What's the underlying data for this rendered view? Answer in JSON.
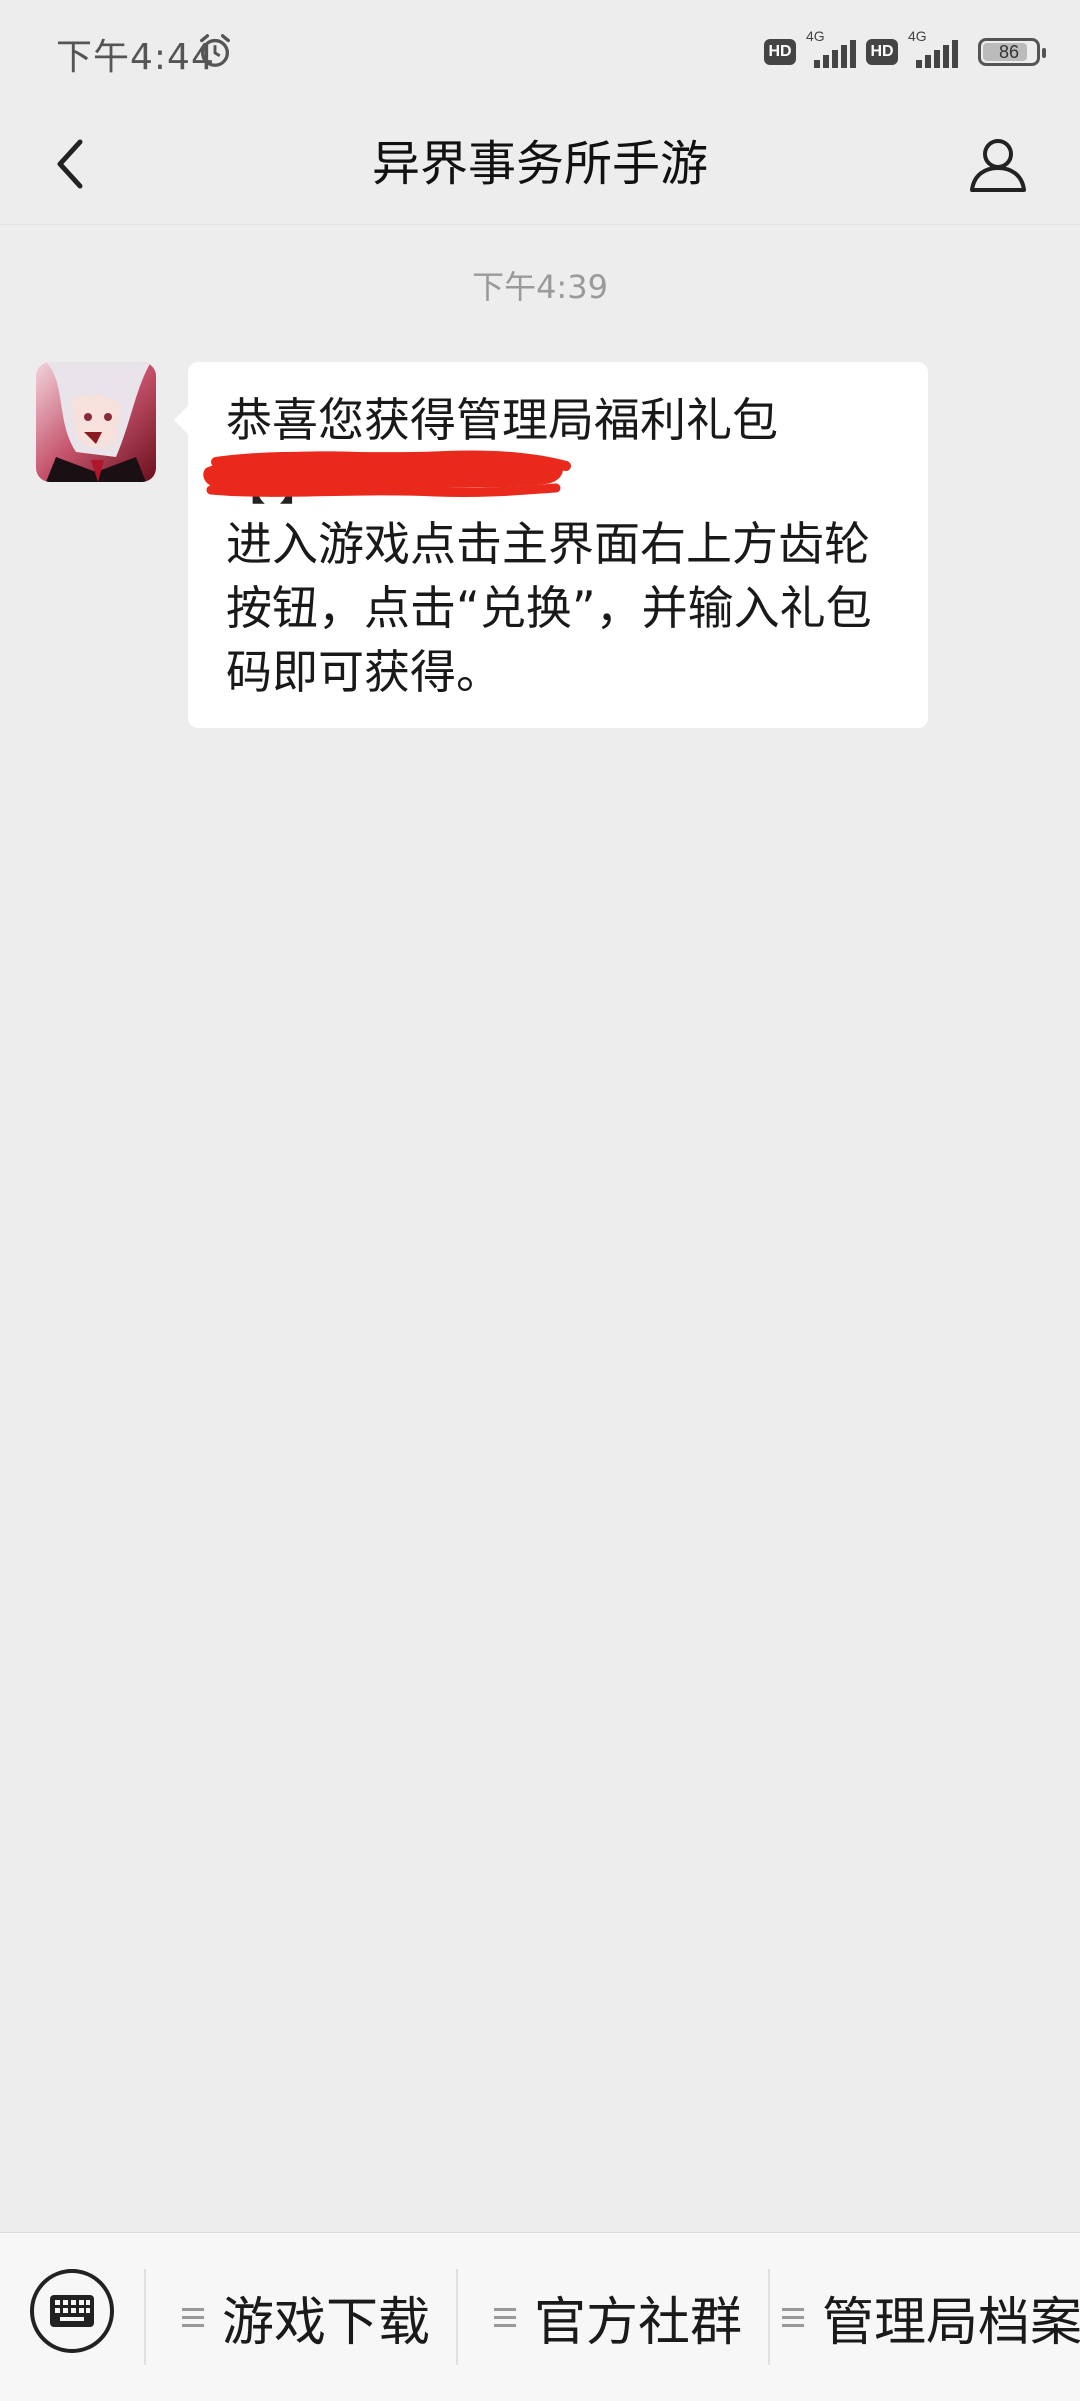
{
  "status_bar": {
    "time": "下午4:44",
    "alarm_icon": "alarm-clock-icon",
    "hd_label": "HD",
    "network_1": "4G",
    "network_2": "4G",
    "battery_level": "86",
    "battery_fraction": 0.86
  },
  "nav": {
    "title": "异界事务所手游",
    "back_icon": "chevron-left-icon",
    "profile_icon": "person-icon"
  },
  "chat": {
    "timestamp": "下午4:39",
    "message": {
      "line1": "恭喜您获得管理局福利礼包",
      "code_line": "【                 】",
      "line2": "进入游戏点击主界面右上方齿轮按钮，点击“兑换”，并输入礼包码即可获得。"
    }
  },
  "menu": {
    "keyboard_icon": "keyboard-icon",
    "items": [
      {
        "label": "游戏下载",
        "icon": "menu-lines-icon"
      },
      {
        "label": "官方社群",
        "icon": "menu-lines-icon"
      },
      {
        "label": "管理局档案",
        "icon": "menu-lines-icon"
      }
    ]
  },
  "colors": {
    "background": "#ededed",
    "bubble": "#ffffff",
    "redaction": "#e8291c",
    "menu_bar": "#f7f7f7"
  }
}
